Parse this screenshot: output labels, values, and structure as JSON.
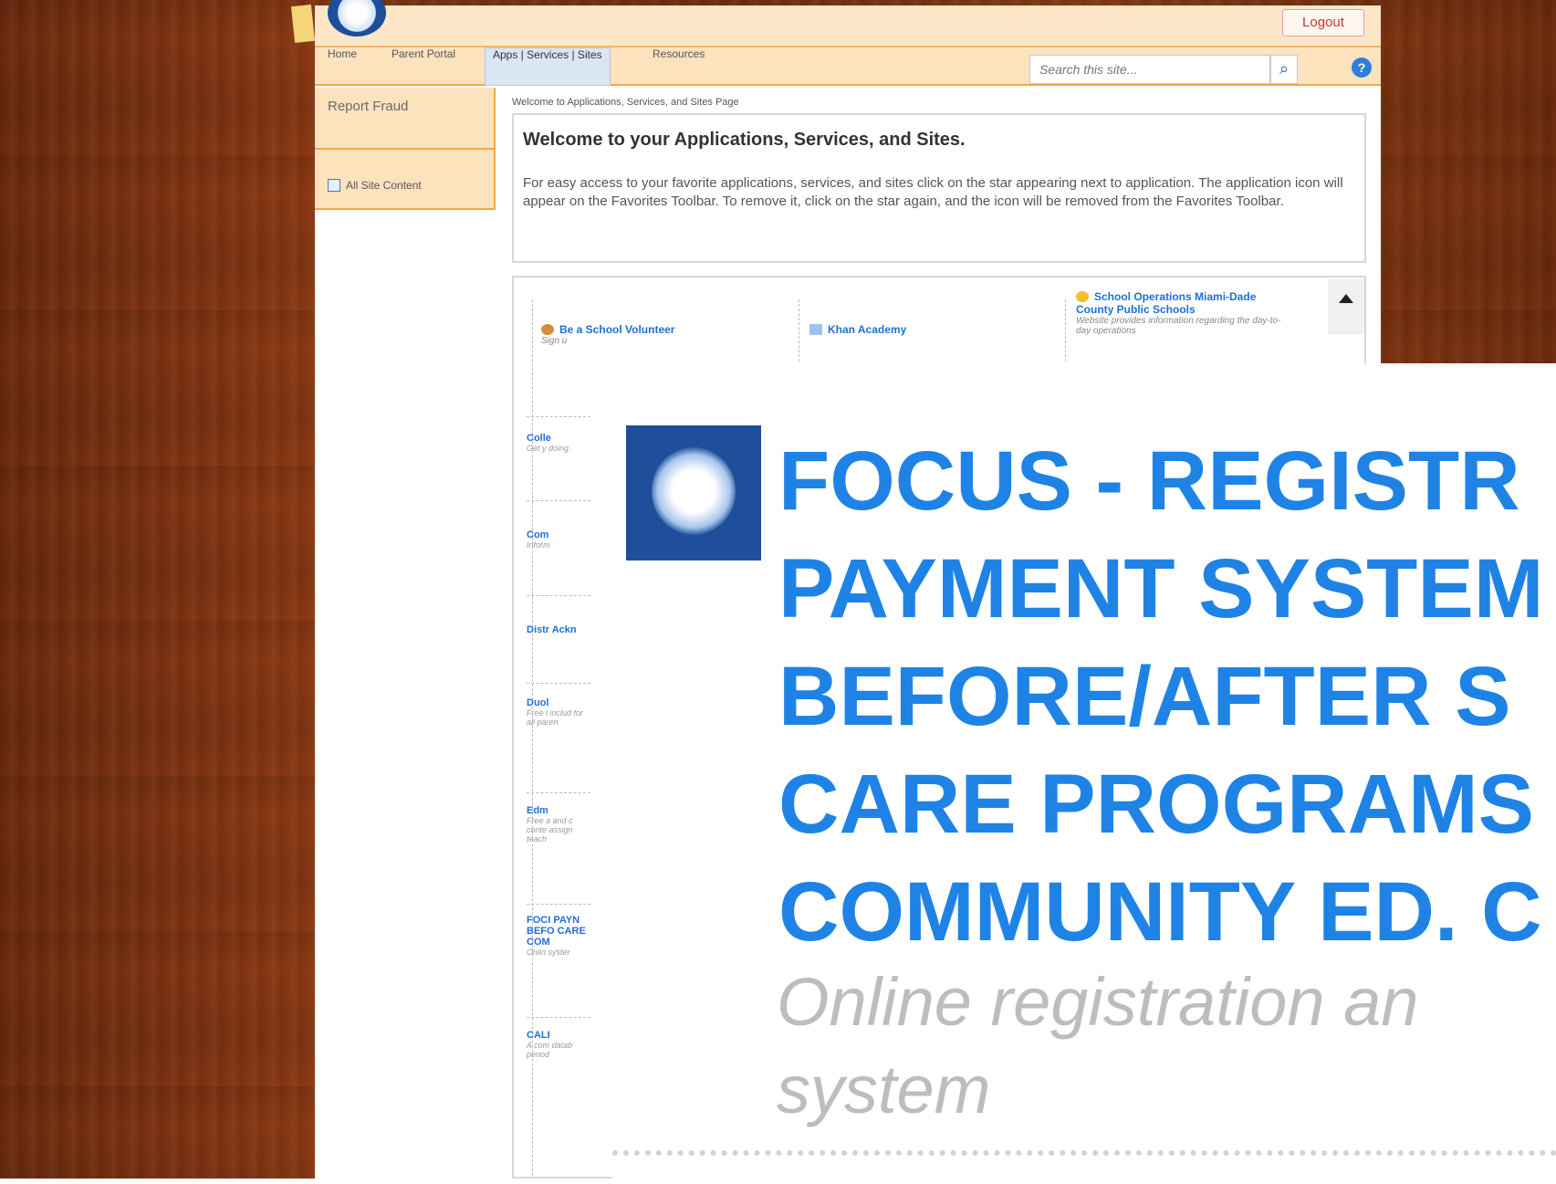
{
  "top": {
    "logout": "Logout"
  },
  "nav": {
    "items": [
      "Home",
      "Parent Portal",
      "Apps | Services | Sites",
      "Resources"
    ],
    "search_placeholder": "Search this site..."
  },
  "left_nav": {
    "report_fraud": "Report Fraud",
    "all_site_content": "All Site Content"
  },
  "main": {
    "breadcrumb": "Welcome to Applications, Services, and Sites Page",
    "welcome_title": "Welcome to your Applications, Services, and Sites.",
    "welcome_text": "For easy access to your favorite applications, services, and sites click on the star appearing next to application. The application icon will appear on the Favorites Toolbar.  To remove it, click on the star again, and the icon will be removed from the Favorites Toolbar."
  },
  "apps": {
    "tile_1_title": "Be a School Volunteer",
    "tile_1_desc": "Sign u",
    "tile_2_title": "Khan Academy",
    "tile_3_title": "School Operations Miami-Dade County Public Schools",
    "tile_3_desc": "Website provides information regarding the day-to-day operations",
    "rows": [
      {
        "title": "Colle",
        "desc": "Get y doing"
      },
      {
        "title": "Com",
        "desc": "Inform"
      },
      {
        "title": "Distr Ackn",
        "desc": ""
      },
      {
        "title": "Duol",
        "desc": "Free i includ for all paren"
      },
      {
        "title": "Edm",
        "desc": "Free a and c conte assign teach"
      },
      {
        "title": "FOCI PAYN BEFO CARE COM",
        "desc": "Onlin syster"
      },
      {
        "title": "CALI",
        "desc": "A com datab period"
      }
    ]
  },
  "zoom": {
    "title_lines": [
      "FOCUS - REGISTR",
      "PAYMENT SYSTEM",
      "BEFORE/AFTER S",
      "CARE PROGRAMS",
      "COMMUNITY ED. C"
    ],
    "desc_lines": [
      "Online registration an",
      "system"
    ]
  }
}
